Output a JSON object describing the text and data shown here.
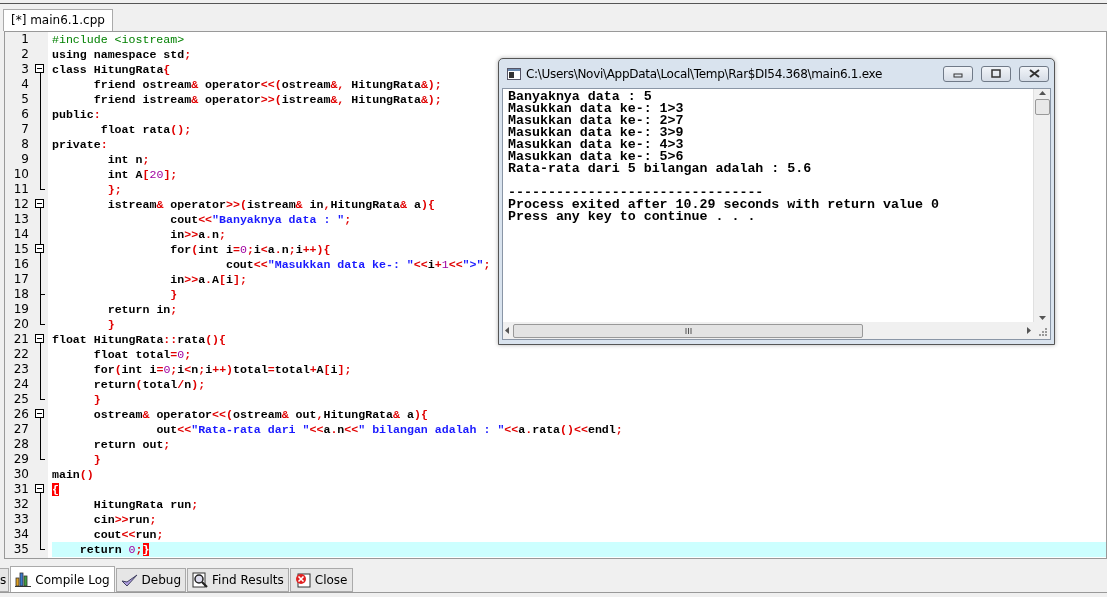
{
  "editor_tabs": [
    {
      "label": "[*] main6.1.cpp",
      "selected": true
    }
  ],
  "code": {
    "lines": [
      {
        "number": "1",
        "text": "#include <iostream>",
        "kind": "plain",
        "current": false
      },
      {
        "number": "2",
        "text": "using namespace std;",
        "kind": "plain",
        "current": false
      },
      {
        "number": "3",
        "text": "class HitungRata{",
        "kind": "open",
        "current": false,
        "brace_match": false
      },
      {
        "number": "4",
        "text": "      friend ostream& operator<<(ostream&, HitungRata&);",
        "kind": "inner",
        "current": false
      },
      {
        "number": "5",
        "text": "      friend istream& operator>>(istream&, HitungRata&);",
        "kind": "inner",
        "current": false
      },
      {
        "number": "6",
        "text": "public:",
        "kind": "inner",
        "current": false
      },
      {
        "number": "7",
        "text": "       float rata();",
        "kind": "inner",
        "current": false
      },
      {
        "number": "8",
        "text": "private:",
        "kind": "inner",
        "current": false
      },
      {
        "number": "9",
        "text": "        int n;",
        "kind": "inner",
        "current": false
      },
      {
        "number": "10",
        "text": "        int A[20];",
        "kind": "inner",
        "current": false
      },
      {
        "number": "11",
        "text": "        };",
        "kind": "end",
        "current": false,
        "brace_match": false
      },
      {
        "number": "12",
        "text": "        istream& operator>>(istream& in,HitungRata& a){",
        "kind": "open",
        "current": false,
        "brace_match": false
      },
      {
        "number": "13",
        "text": "                 cout<<\"Banyaknya data : \";",
        "kind": "inner",
        "current": false
      },
      {
        "number": "14",
        "text": "                 in>>a.n;",
        "kind": "inner",
        "current": false
      },
      {
        "number": "15",
        "text": "                 for(int i=0;i<a.n;i++){",
        "kind": "open",
        "current": false,
        "brace_match": false
      },
      {
        "number": "16",
        "text": "                         cout<<\"Masukkan data ke-: \"<<i+1<<\">\";",
        "kind": "inner",
        "current": false
      },
      {
        "number": "17",
        "text": "                 in>>a.A[i];",
        "kind": "inner",
        "current": false
      },
      {
        "number": "18",
        "text": "                 }",
        "kind": "branch",
        "current": false,
        "brace_match": false
      },
      {
        "number": "19",
        "text": "        return in;",
        "kind": "inner",
        "current": false
      },
      {
        "number": "20",
        "text": "        }",
        "kind": "end",
        "current": false,
        "brace_match": false
      },
      {
        "number": "21",
        "text": "float HitungRata::rata(){",
        "kind": "open",
        "current": false,
        "brace_match": false
      },
      {
        "number": "22",
        "text": "      float total=0;",
        "kind": "inner",
        "current": false
      },
      {
        "number": "23",
        "text": "      for(int i=0;i<n;i++)total=total+A[i];",
        "kind": "inner",
        "current": false
      },
      {
        "number": "24",
        "text": "      return(total/n);",
        "kind": "inner",
        "current": false
      },
      {
        "number": "25",
        "text": "      }",
        "kind": "end",
        "current": false,
        "brace_match": false
      },
      {
        "number": "26",
        "text": "      ostream& operator<<(ostream& out,HitungRata& a){",
        "kind": "open",
        "current": false,
        "brace_match": false
      },
      {
        "number": "27",
        "text": "               out<<\"Rata-rata dari \"<<a.n<<\" bilangan adalah : \"<<a.rata()<<endl;",
        "kind": "inner",
        "current": false
      },
      {
        "number": "28",
        "text": "      return out;",
        "kind": "inner",
        "current": false
      },
      {
        "number": "29",
        "text": "      }",
        "kind": "end",
        "current": false,
        "brace_match": false
      },
      {
        "number": "30",
        "text": "main()",
        "kind": "plain",
        "current": false
      },
      {
        "number": "31",
        "text": "{",
        "kind": "open",
        "current": false,
        "brace_match": true
      },
      {
        "number": "32",
        "text": "      HitungRata run;",
        "kind": "inner",
        "current": false
      },
      {
        "number": "33",
        "text": "      cin>>run;",
        "kind": "inner",
        "current": false
      },
      {
        "number": "34",
        "text": "      cout<<run;",
        "kind": "inner",
        "current": false
      },
      {
        "number": "35",
        "text": "    return 0;}",
        "kind": "end",
        "current": true,
        "brace_match": true
      }
    ]
  },
  "console": {
    "title": "C:\\Users\\Novi\\AppData\\Local\\Temp\\Rar$DI54.368\\main6.1.exe",
    "output_lines": [
      "Banyaknya data : 5",
      "Masukkan data ke-: 1>3",
      "Masukkan data ke-: 2>7",
      "Masukkan data ke-: 3>9",
      "Masukkan data ke-: 4>3",
      "Masukkan data ke-: 5>6",
      "Rata-rata dari 5 bilangan adalah : 5.6"
    ],
    "footer_lines": [
      "--------------------------------",
      "Process exited after 10.29 seconds with return value 0",
      "Press any key to continue . . ."
    ]
  },
  "bottom_tabs": [
    {
      "label": "s",
      "kind": "plain",
      "selected": false
    },
    {
      "label": "Compile Log",
      "kind": "chart",
      "selected": true
    },
    {
      "label": "Debug",
      "kind": "check",
      "selected": false
    },
    {
      "label": "Find Results",
      "kind": "find",
      "selected": false
    },
    {
      "label": "Close",
      "kind": "close",
      "selected": false
    }
  ]
}
